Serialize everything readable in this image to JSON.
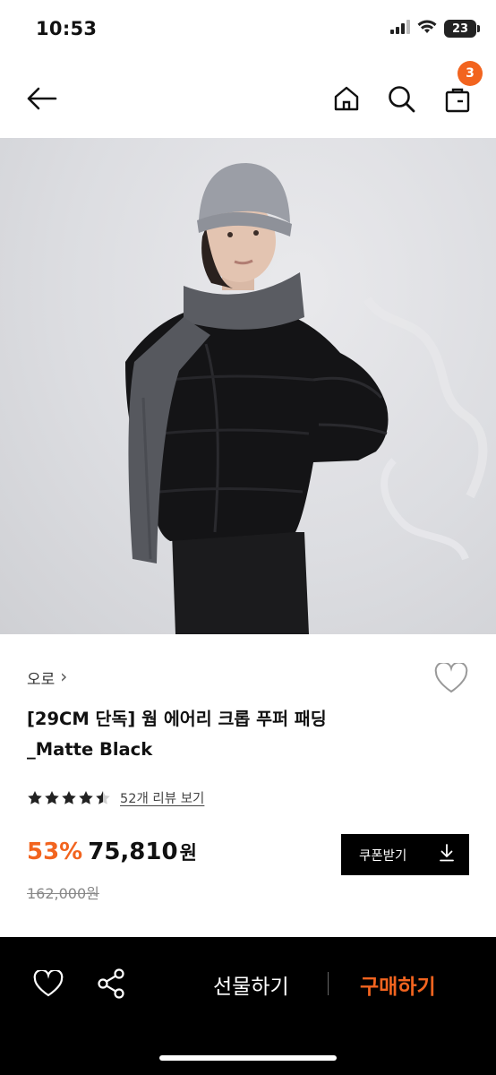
{
  "status_bar": {
    "time": "10:53",
    "battery": "23"
  },
  "header": {
    "cart_count": "3"
  },
  "product": {
    "brand": "오로",
    "brand_chevron": "›",
    "title_line1": "[29CM 단독] 웜 에어리 크롭 푸퍼 패딩",
    "title_line2": "_Matte Black",
    "rating": 4.5,
    "review_link": "52개 리뷰 보기",
    "discount": "53%",
    "price": "75,810",
    "currency": "원",
    "original_price": "162,000원",
    "coupon_label": "쿠폰받기"
  },
  "bottom_bar": {
    "gift_label": "선물하기",
    "buy_label": "구매하기"
  },
  "colors": {
    "accent": "#f2641f",
    "dark": "#000000"
  },
  "icons": [
    "back-arrow-icon",
    "home-icon",
    "search-icon",
    "cart-icon",
    "heart-icon",
    "star-icon",
    "download-icon",
    "share-icon"
  ]
}
